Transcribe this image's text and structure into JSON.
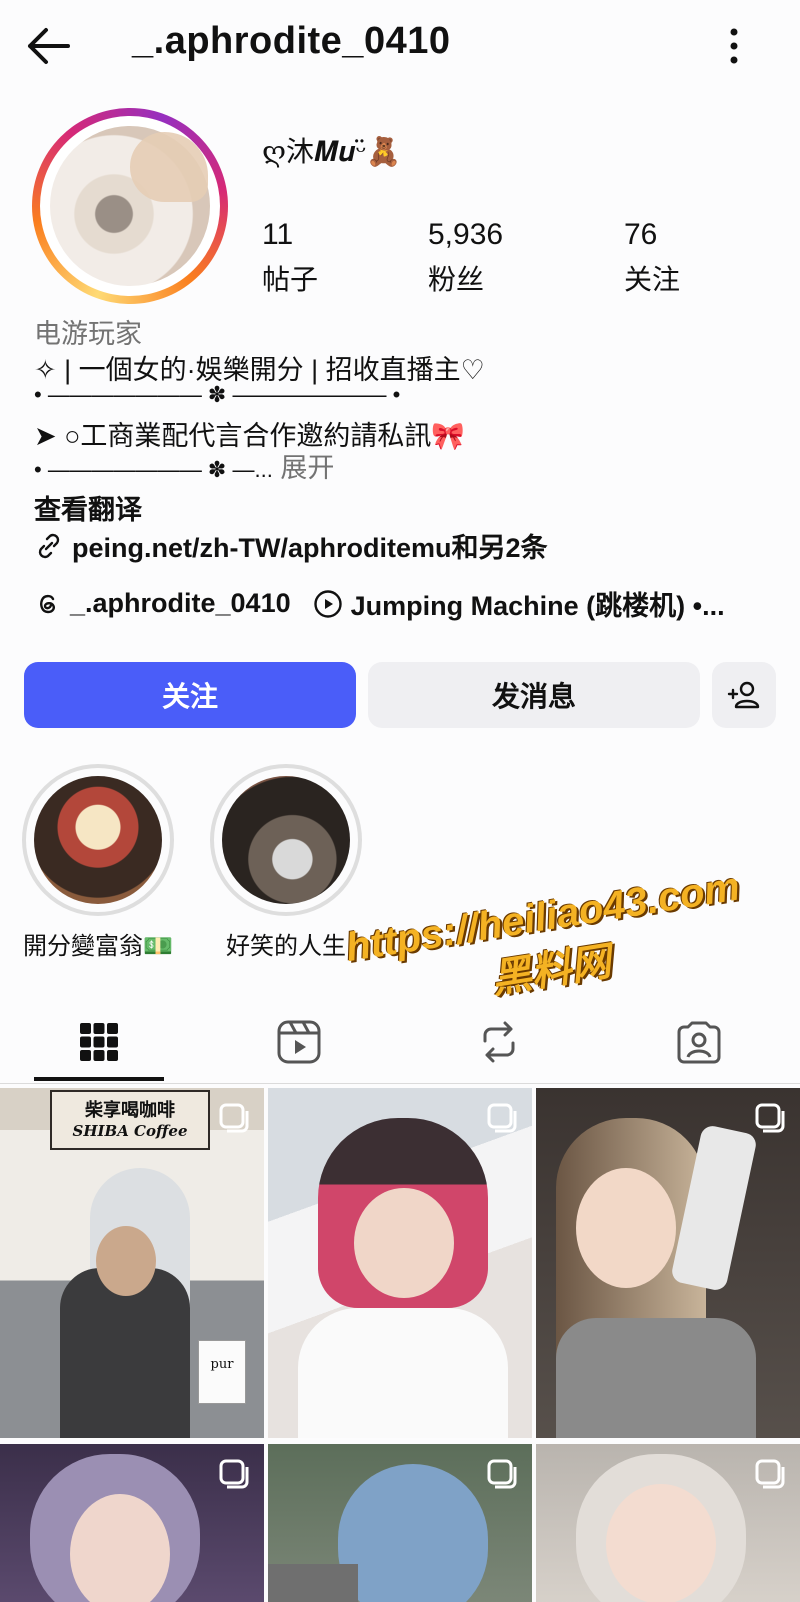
{
  "header": {
    "username": "_.aphrodite_0410"
  },
  "profile": {
    "display_name": "ღ沐𝑴𝒖ᵕ̈🧸",
    "stats": [
      {
        "value": "11",
        "label": "帖子"
      },
      {
        "value": "5,936",
        "label": "粉丝"
      },
      {
        "value": "76",
        "label": "关注"
      }
    ],
    "category": "电游玩家",
    "bio_lines": [
      "✧ | 一個女的·娛樂開分 | 招收直播主♡",
      "• ——————— ✽ ——————— •",
      "➤ ○工商業配代言合作邀約請私訊🎀"
    ],
    "bio_last_prefix": "• ——————— ✽ —...",
    "bio_more": "展开",
    "translate": "查看翻译",
    "link": "peing.net/zh-TW/aphroditemu和另2条",
    "threads_handle": "_.aphrodite_0410",
    "music": "Jumping Machine (跳楼机) •..."
  },
  "actions": {
    "follow": "关注",
    "message": "发消息"
  },
  "highlights": [
    {
      "label": "開分變富翁💵"
    },
    {
      "label": "好笑的人生"
    }
  ],
  "watermark": {
    "line1": "https://heiliao43.com",
    "line2": "黑料网"
  },
  "tabs": [
    {
      "icon": "grid-icon"
    },
    {
      "icon": "reels-icon"
    },
    {
      "icon": "repost-icon"
    },
    {
      "icon": "tagged-icon"
    }
  ],
  "posts": [
    {
      "caption_sign": "柴享喝咖啡",
      "caption_sign_en": "SHIBA Coffee",
      "sign_small": "pur"
    }
  ]
}
